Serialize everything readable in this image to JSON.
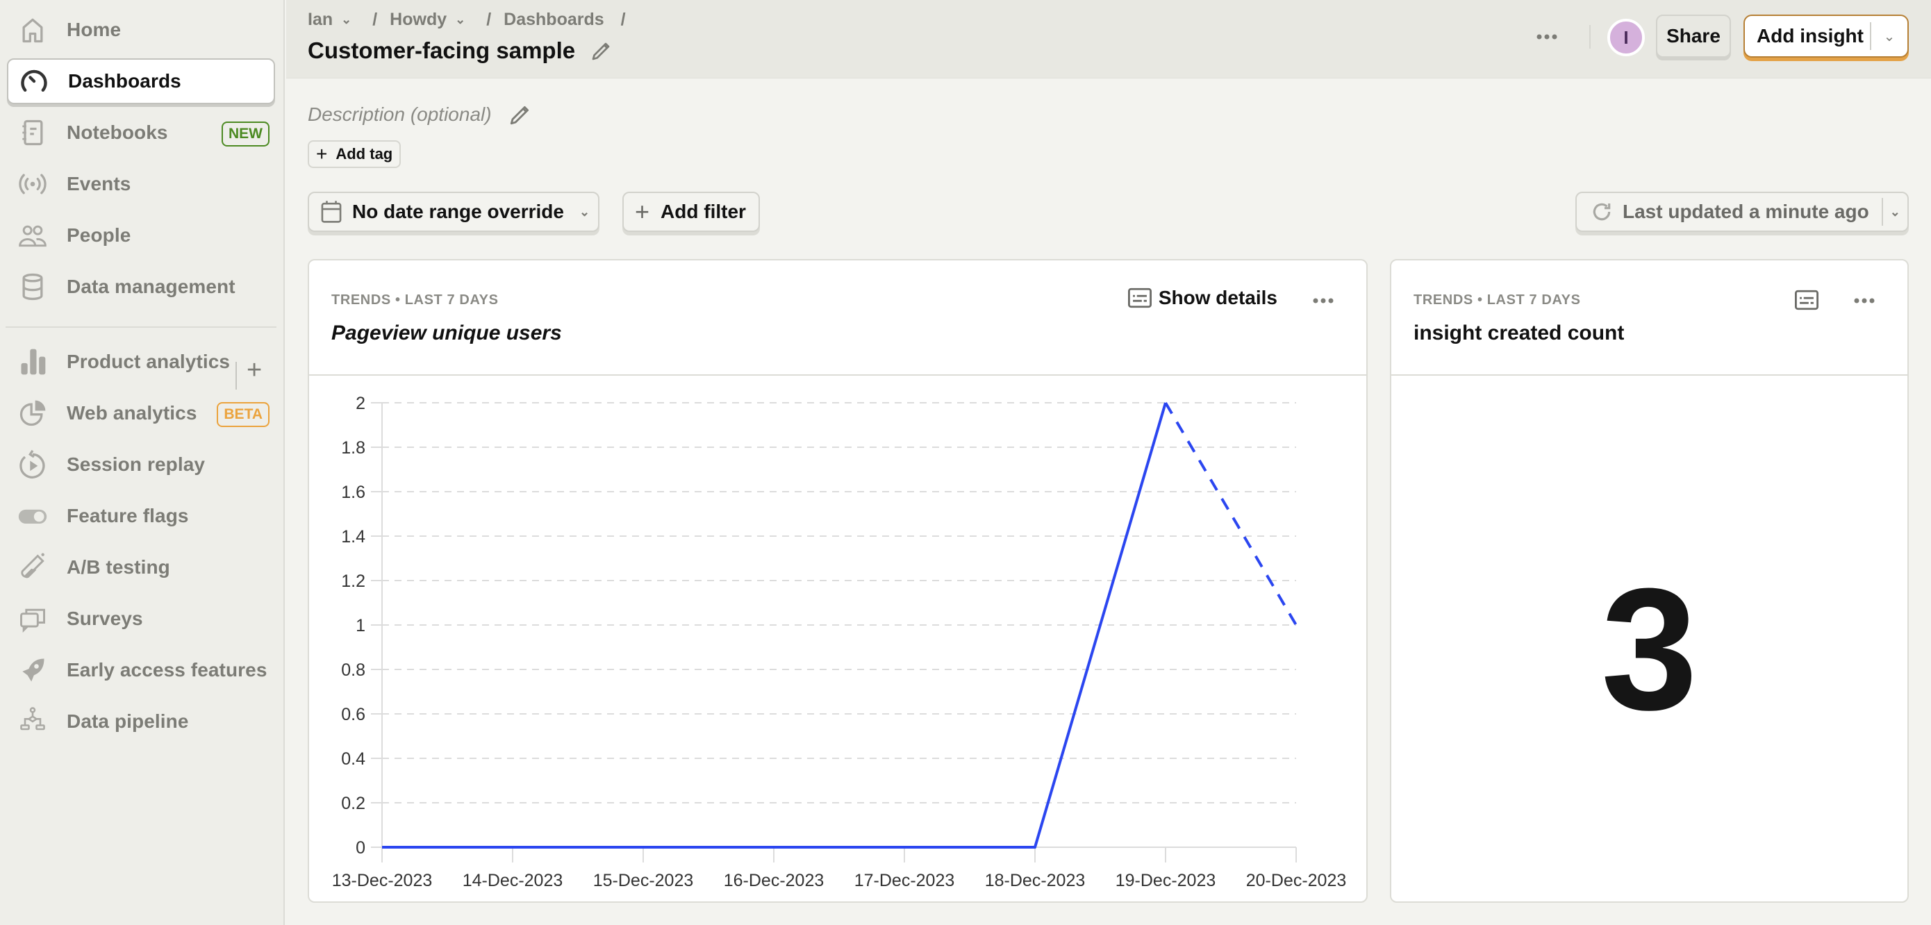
{
  "sidebar": {
    "items": [
      {
        "label": "Home",
        "icon": "home-icon"
      },
      {
        "label": "Dashboards",
        "icon": "dashboard-gauge-icon",
        "active": true
      },
      {
        "label": "Notebooks",
        "icon": "notebook-icon",
        "badge": "NEW"
      },
      {
        "label": "Events",
        "icon": "broadcast-icon"
      },
      {
        "label": "People",
        "icon": "people-icon"
      },
      {
        "label": "Data management",
        "icon": "database-icon"
      },
      {
        "label": "Product analytics",
        "icon": "bar-chart-icon",
        "action": "+"
      },
      {
        "label": "Web analytics",
        "icon": "pie-chart-icon",
        "badge": "BETA"
      },
      {
        "label": "Session replay",
        "icon": "replay-icon"
      },
      {
        "label": "Feature flags",
        "icon": "toggle-icon"
      },
      {
        "label": "A/B testing",
        "icon": "flask-icon"
      },
      {
        "label": "Surveys",
        "icon": "chat-bubbles-icon"
      },
      {
        "label": "Early access features",
        "icon": "rocket-icon"
      },
      {
        "label": "Data pipeline",
        "icon": "pipeline-icon"
      }
    ]
  },
  "header": {
    "breadcrumbs": [
      "Ian",
      "Howdy",
      "Dashboards"
    ],
    "title": "Customer-facing sample",
    "avatar_initial": "I",
    "share_label": "Share",
    "add_insight_label": "Add insight"
  },
  "dashboard": {
    "description_placeholder": "Description (optional)",
    "add_tag_label": "Add tag",
    "date_range_label": "No date range override",
    "add_filter_label": "Add filter",
    "last_updated_label": "Last updated a minute ago"
  },
  "cards": [
    {
      "meta": "TRENDS • LAST 7 DAYS",
      "title": "Pageview unique users",
      "show_details_label": "Show details"
    },
    {
      "meta": "TRENDS • LAST 7 DAYS",
      "title": "insight created count",
      "value": "3"
    }
  ],
  "colors": {
    "series": "#2b46f0",
    "accent": "#e4a247",
    "new_badge": "#4c8a22",
    "beta_badge": "#eba33d"
  },
  "chart_data": {
    "type": "line",
    "title": "Pageview unique users",
    "categories": [
      "13-Dec-2023",
      "14-Dec-2023",
      "15-Dec-2023",
      "16-Dec-2023",
      "17-Dec-2023",
      "18-Dec-2023",
      "19-Dec-2023",
      "20-Dec-2023"
    ],
    "series": [
      {
        "name": "Pageview unique users",
        "values": [
          0,
          0,
          0,
          0,
          0,
          0,
          2,
          1
        ],
        "incomplete_from_index": 6
      }
    ],
    "yticks": [
      "0",
      "0.2",
      "0.4",
      "0.6",
      "0.8",
      "1",
      "1.2",
      "1.4",
      "1.6",
      "1.8",
      "2"
    ],
    "ylim": [
      0,
      2
    ],
    "grid": true,
    "xlabel": "",
    "ylabel": ""
  }
}
